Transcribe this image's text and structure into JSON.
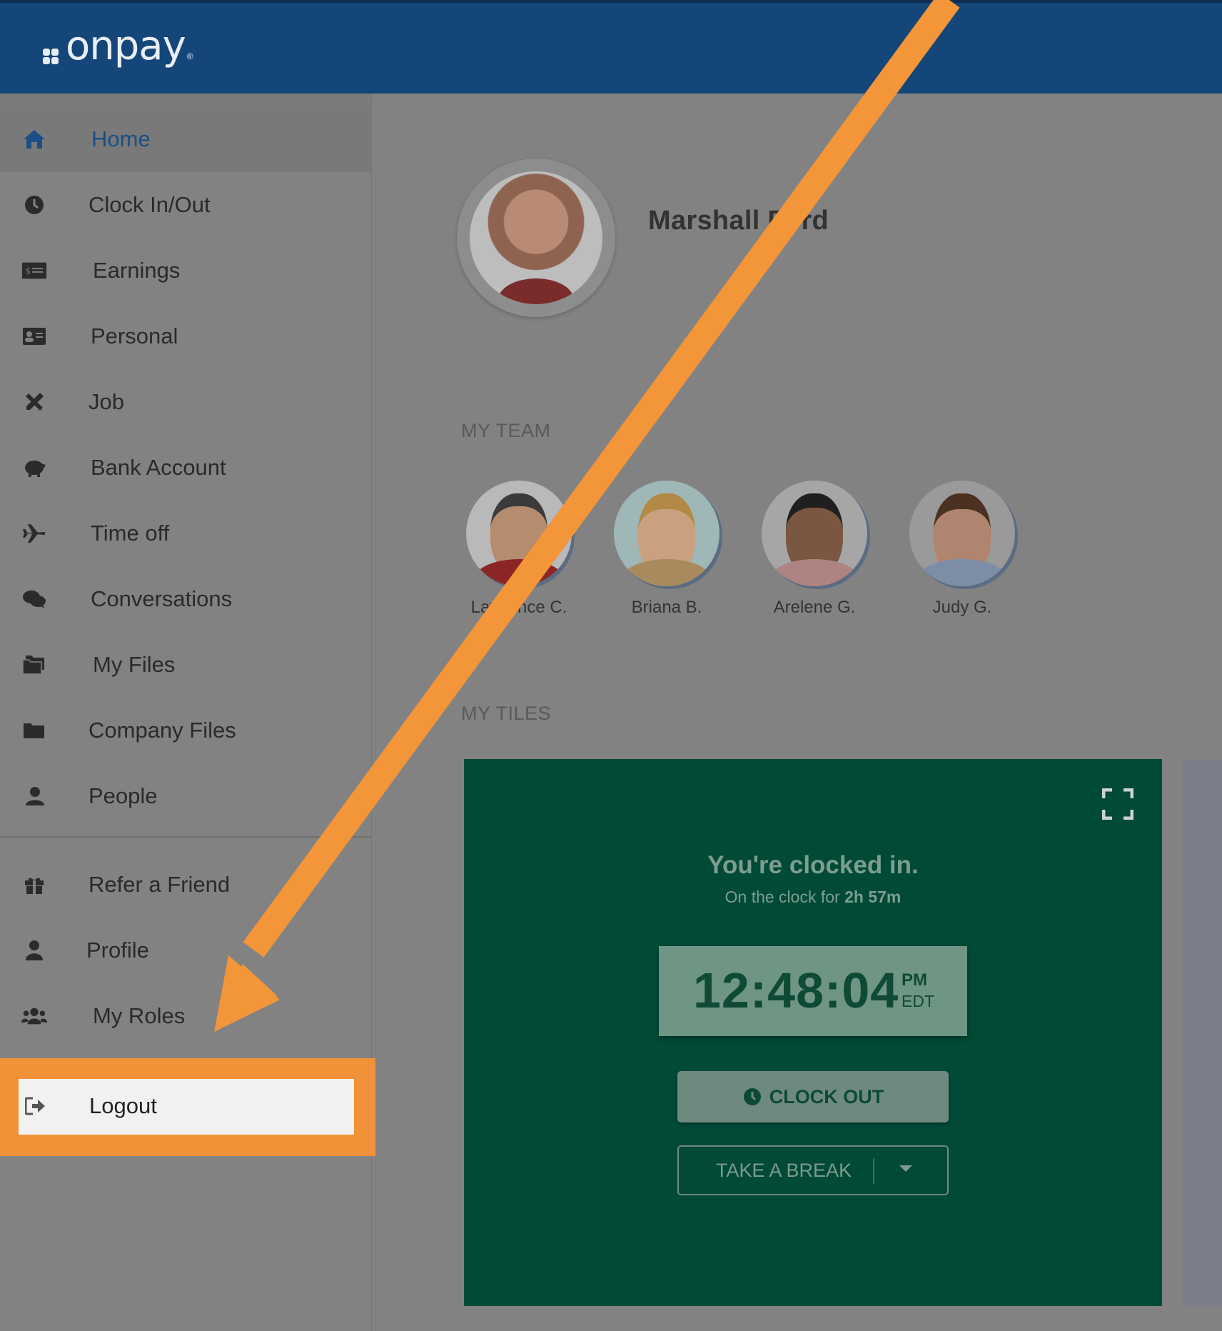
{
  "header": {
    "logo_text": "onpay",
    "logo_reg": "®",
    "brand_color": "#14467a"
  },
  "sidebar": {
    "items": [
      {
        "label": "Home",
        "icon": "home-icon",
        "active": true
      },
      {
        "label": "Clock In/Out",
        "icon": "clock-icon"
      },
      {
        "label": "Earnings",
        "icon": "money-icon"
      },
      {
        "label": "Personal",
        "icon": "id-card-icon"
      },
      {
        "label": "Job",
        "icon": "tools-icon"
      },
      {
        "label": "Bank Account",
        "icon": "piggy-bank-icon"
      },
      {
        "label": "Time off",
        "icon": "plane-icon"
      },
      {
        "label": "Conversations",
        "icon": "chat-icon"
      },
      {
        "label": "My Files",
        "icon": "files-icon"
      },
      {
        "label": "Company Files",
        "icon": "folder-icon"
      },
      {
        "label": "People",
        "icon": "people-icon"
      }
    ],
    "secondary": [
      {
        "label": "Refer a Friend",
        "icon": "gift-icon"
      },
      {
        "label": "Profile",
        "icon": "user-icon"
      },
      {
        "label": "My Roles",
        "icon": "group-icon"
      }
    ],
    "logout": {
      "label": "Logout",
      "icon": "logout-icon"
    },
    "highlight_color": "#f29238"
  },
  "profile": {
    "name": "Marshall Ford"
  },
  "team": {
    "section_label": "MY TEAM",
    "members": [
      {
        "name": "Lawrence C."
      },
      {
        "name": "Briana B."
      },
      {
        "name": "Arelene G."
      },
      {
        "name": "Judy G."
      }
    ]
  },
  "tiles": {
    "section_label": "MY TILES",
    "clock_tile": {
      "title": "You're clocked in.",
      "subtitle_prefix": "On the clock for ",
      "duration": "2h 57m",
      "time": "12:48:04",
      "ampm": "PM",
      "timezone": "EDT",
      "clock_out_label": "CLOCK OUT",
      "break_label": "TAKE A BREAK",
      "tile_color": "#004a36"
    }
  }
}
